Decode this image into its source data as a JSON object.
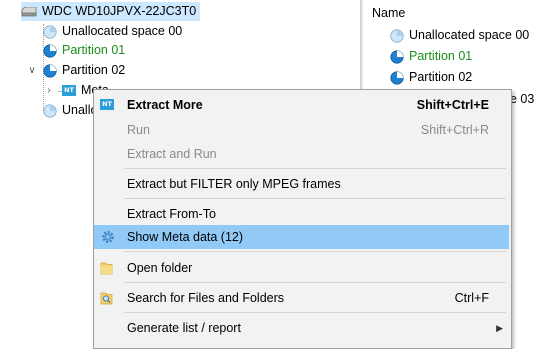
{
  "tree": {
    "root_label": "WDC WD10JPVX-22JC3T0",
    "items": [
      {
        "label": "Unallocated space 00"
      },
      {
        "label": "Partition 01"
      },
      {
        "label": "Partition 02"
      },
      {
        "label": "Meta"
      },
      {
        "label": "Unallo"
      }
    ],
    "colors": {
      "selection": "#cce8ff",
      "green_text": "#1a8f1a"
    }
  },
  "list": {
    "column_header": "Name",
    "items": [
      {
        "label": "Unallocated space 00"
      },
      {
        "label": "Partition 01"
      },
      {
        "label": "Partition 02"
      },
      {
        "label": "e 03"
      }
    ]
  },
  "context_menu": {
    "items": [
      {
        "label": "Extract More",
        "shortcut": "Shift+Ctrl+E",
        "icon": "nt-icon"
      },
      {
        "label": "Run",
        "shortcut": "Shift+Ctrl+R"
      },
      {
        "label": "Extract and Run"
      },
      {
        "label": "Extract but FILTER only MPEG frames"
      },
      {
        "label": "Extract From-To"
      },
      {
        "label": "Show Meta data (12)",
        "icon": "gear-icon"
      },
      {
        "label": "Open folder",
        "icon": "folder-icon"
      },
      {
        "label": "Search for Files and Folders",
        "shortcut": "Ctrl+F",
        "icon": "search-folder-icon"
      },
      {
        "label": "Generate list / report",
        "icon": "chevron-right-icon"
      }
    ],
    "nt_badge": "NT",
    "highlight_color": "#91c9f7"
  }
}
